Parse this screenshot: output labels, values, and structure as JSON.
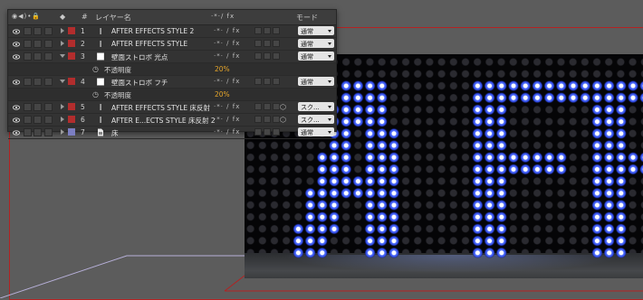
{
  "colors": {
    "label_red": "#b22d2d",
    "label_purple": "#7b7ec2",
    "value_orange": "#e5a52a",
    "bulb_blue": "#3f63ff",
    "comp_border": "#b32222"
  },
  "layer_panel": {
    "col_name": "レイヤー名",
    "col_hash": "#",
    "col_switches": "·*·∕ fx",
    "col_mode": "モード",
    "rows": [
      {
        "num": "1",
        "name": "AFTER EFFECTS STYLE 2",
        "mode": "通常",
        "label": "label_red",
        "type": "text",
        "expanded": false
      },
      {
        "num": "2",
        "name": "AFTER EFFECTS STYLE",
        "mode": "通常",
        "label": "label_red",
        "type": "text",
        "expanded": false
      },
      {
        "num": "3",
        "name": "壁面ストロボ 光点",
        "mode": "通常",
        "label": "label_red",
        "type": "solid",
        "expanded": true
      },
      {
        "num": "4",
        "name": "壁面ストロボ フチ",
        "mode": "通常",
        "label": "label_red",
        "type": "solid",
        "expanded": true
      },
      {
        "num": "5",
        "name": "AFTER EFFECTS STYLE 床反射",
        "mode": "スク...",
        "label": "label_red",
        "type": "text",
        "expanded": false
      },
      {
        "num": "6",
        "name": "AFTER E...ECTS STYLE 床反射 2",
        "mode": "スク...",
        "label": "label_red",
        "type": "text",
        "expanded": false
      },
      {
        "num": "7",
        "name": "床",
        "mode": "通常",
        "label": "label_purple",
        "type": "file",
        "expanded": false
      }
    ],
    "opacity_label": "不透明度",
    "opacity_value_3": "20%",
    "opacity_value_4": "20%"
  }
}
